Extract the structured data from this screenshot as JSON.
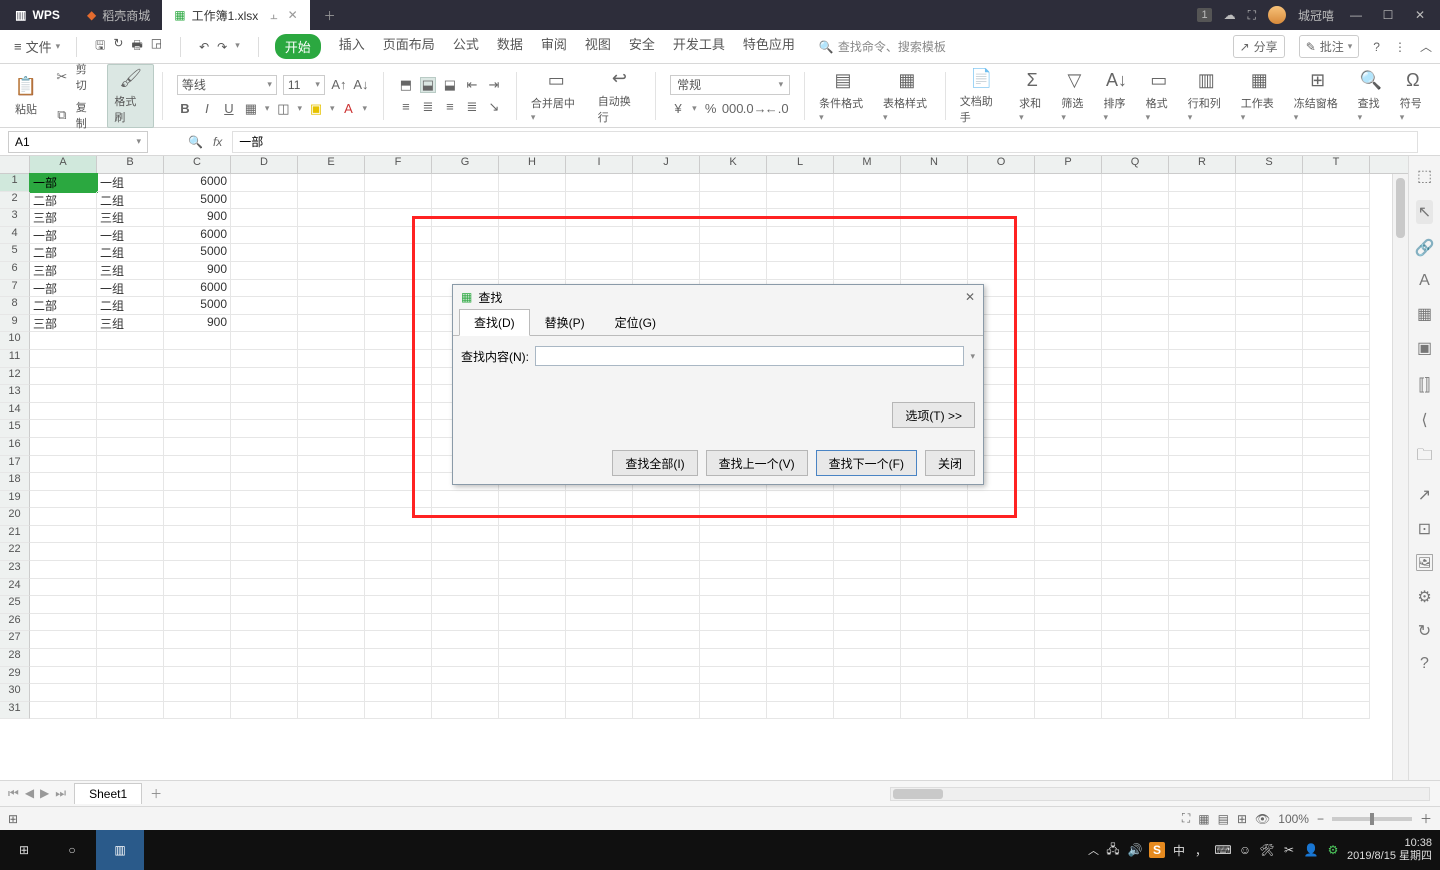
{
  "titlebar": {
    "app": "WPS",
    "tabs": [
      {
        "label": "稻壳商城",
        "active": false
      },
      {
        "label": "工作簿1.xlsx",
        "active": true
      }
    ],
    "user": "城冠嘻",
    "badge": "1"
  },
  "menubar": {
    "file": "文件",
    "tabs": [
      "开始",
      "插入",
      "页面布局",
      "公式",
      "数据",
      "审阅",
      "视图",
      "安全",
      "开发工具",
      "特色应用"
    ],
    "active_tab": "开始",
    "search_placeholder": "查找命令、搜索模板",
    "share": "分享",
    "note": "批注"
  },
  "ribbon": {
    "paste": "粘贴",
    "cut": "剪切",
    "copy": "复制",
    "format_painter": "格式刷",
    "font_name": "等线",
    "font_size": "11",
    "merge": "合并居中",
    "wrap": "自动换行",
    "num_format": "常规",
    "cond_fmt": "条件格式",
    "table_style": "表格样式",
    "doc_helper": "文档助手",
    "sum": "求和",
    "filter": "筛选",
    "sort": "排序",
    "format": "格式",
    "rowcol": "行和列",
    "worksheet": "工作表",
    "freeze": "冻结窗格",
    "find": "查找",
    "symbol": "符号"
  },
  "formulabar": {
    "name": "A1",
    "fx": "fx",
    "value": "一部"
  },
  "columns": [
    "A",
    "B",
    "C",
    "D",
    "E",
    "F",
    "G",
    "H",
    "I",
    "J",
    "K",
    "L",
    "M",
    "N",
    "O",
    "P",
    "Q",
    "R",
    "S",
    "T"
  ],
  "row_count": 31,
  "cells": [
    {
      "r": 1,
      "A": "一部",
      "B": "一组",
      "C": 6000
    },
    {
      "r": 2,
      "A": "二部",
      "B": "二组",
      "C": 5000
    },
    {
      "r": 3,
      "A": "三部",
      "B": "三组",
      "C": 900
    },
    {
      "r": 4,
      "A": "一部",
      "B": "一组",
      "C": 6000
    },
    {
      "r": 5,
      "A": "二部",
      "B": "二组",
      "C": 5000
    },
    {
      "r": 6,
      "A": "三部",
      "B": "三组",
      "C": 900
    },
    {
      "r": 7,
      "A": "一部",
      "B": "一组",
      "C": 6000
    },
    {
      "r": 8,
      "A": "二部",
      "B": "二组",
      "C": 5000
    },
    {
      "r": 9,
      "A": "三部",
      "B": "三组",
      "C": 900
    }
  ],
  "active_cell": "A1",
  "dialog": {
    "title": "查找",
    "tabs": [
      "查找(D)",
      "替换(P)",
      "定位(G)"
    ],
    "active_tab": 0,
    "field_label": "查找内容(N):",
    "options": "选项(T) >>",
    "actions": [
      "查找全部(I)",
      "查找上一个(V)",
      "查找下一个(F)",
      "关闭"
    ],
    "default_action": 2
  },
  "sheet": {
    "tabs": [
      "Sheet1"
    ]
  },
  "statusbar": {
    "zoom": "100%"
  },
  "taskbar": {
    "ime": "中",
    "time": "10:38",
    "date": "2019/8/15 星期四"
  }
}
